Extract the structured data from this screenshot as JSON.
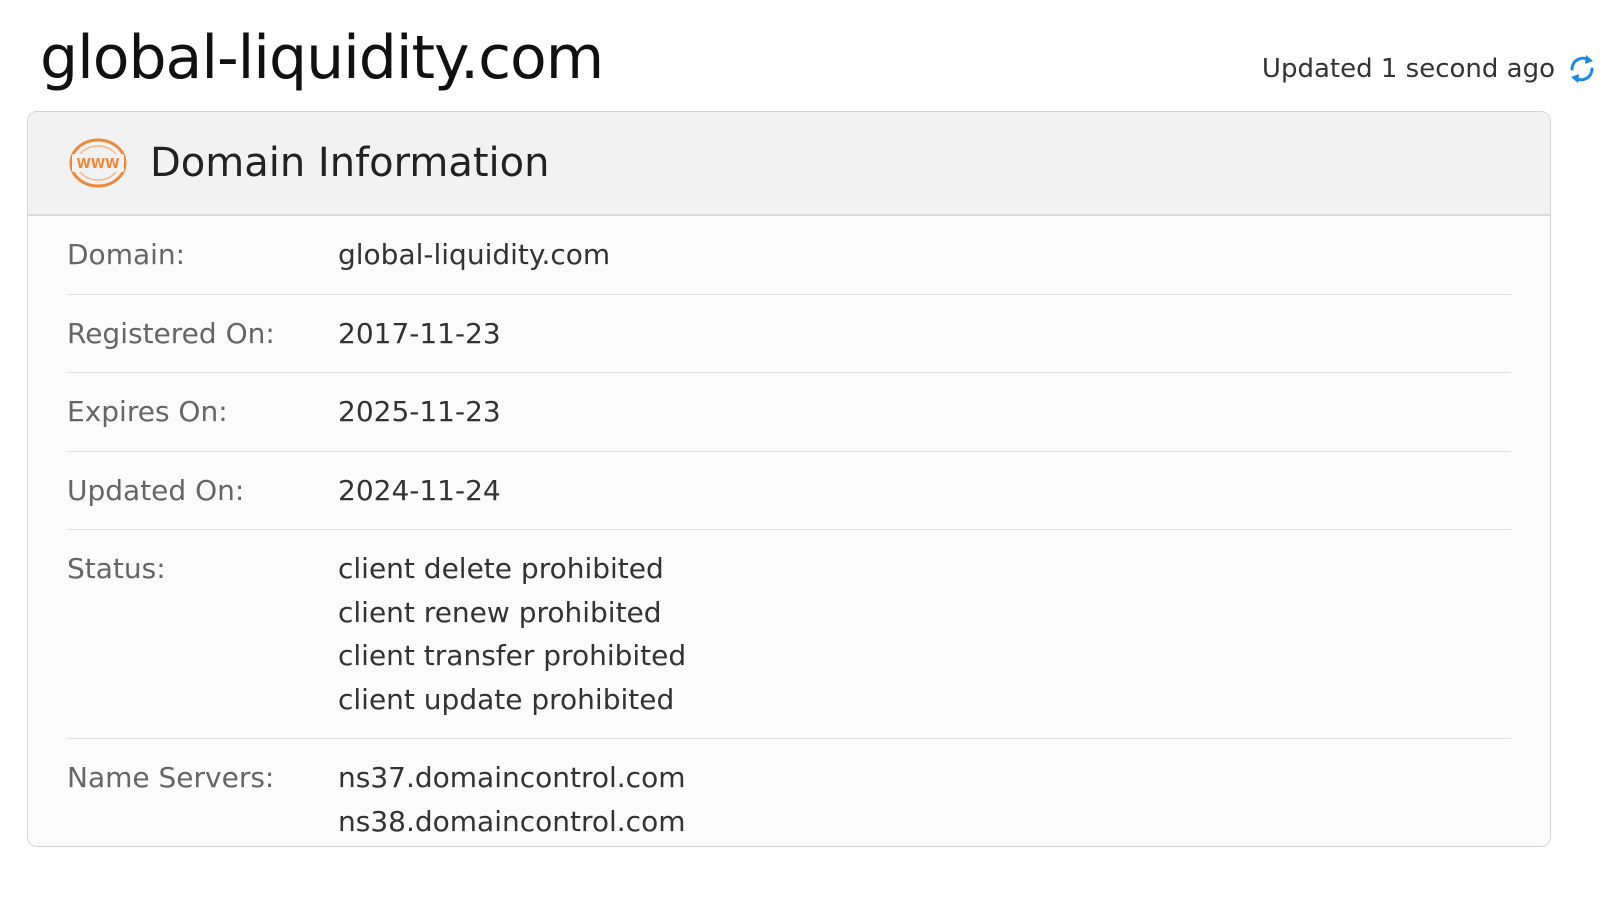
{
  "page": {
    "title": "global-liquidity.com",
    "updated_text": "Updated 1 second ago"
  },
  "card": {
    "title": "Domain Information",
    "icon_name": "www-globe-icon",
    "icon_text": "WWW",
    "accent_color": "#f0883a",
    "rows": [
      {
        "label": "Domain:",
        "values": [
          "global-liquidity.com"
        ]
      },
      {
        "label": "Registered On:",
        "values": [
          "2017-11-23"
        ]
      },
      {
        "label": "Expires On:",
        "values": [
          "2025-11-23"
        ]
      },
      {
        "label": "Updated On:",
        "values": [
          "2024-11-24"
        ]
      },
      {
        "label": "Status:",
        "values": [
          "client delete prohibited",
          "client renew prohibited",
          "client transfer prohibited",
          "client update prohibited"
        ]
      },
      {
        "label": "Name Servers:",
        "values": [
          "ns37.domaincontrol.com",
          "ns38.domaincontrol.com"
        ]
      }
    ]
  },
  "colors": {
    "refresh_icon": "#1e88e5",
    "header_bg": "#f2f2f2"
  }
}
